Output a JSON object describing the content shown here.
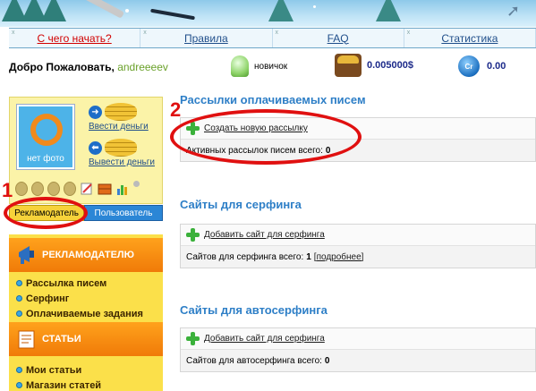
{
  "nav": {
    "tag": "x",
    "items": [
      {
        "label": "С чего начать?"
      },
      {
        "label": "Правила"
      },
      {
        "label": "FAQ"
      },
      {
        "label": "Статистика"
      }
    ]
  },
  "user": {
    "welcome": "Добро Пожаловать,",
    "username": "andreeeev",
    "rank": "новичок",
    "balance": "0.005000$",
    "credits": "0.00",
    "credit_icon_text": "Cr"
  },
  "profile": {
    "avatar_caption": "нет фото",
    "deposit_label": "Ввести деньги",
    "withdraw_label": "Вывести деньги"
  },
  "tabs": {
    "advertiser": "Рекламодатель",
    "user": "Пользователь"
  },
  "menu": {
    "advertiser_header": "РЕКЛАМОДАТЕЛЮ",
    "advertiser_items": [
      "Рассылка писем",
      "Серфинг",
      "Оплачиваемые задания"
    ],
    "articles_header": "СТАТЬИ",
    "articles_items": [
      "Мои статьи",
      "Магазин статей"
    ]
  },
  "main": {
    "mailings": {
      "title": "Рассылки оплачиваемых писем",
      "action": "Создать новую рассылку",
      "stat_label": "Активных рассылок писем всего:",
      "stat_value": "0"
    },
    "surfing": {
      "title": "Сайты для серфинга",
      "action": "Добавить сайт для серфинга",
      "stat_label": "Сайтов для серфинга всего:",
      "stat_value": "1",
      "more": "[подробнее]"
    },
    "autosurfing": {
      "title": "Сайты для автосерфинга",
      "action": "Добавить сайт для серфинга",
      "stat_label": "Сайтов для автосерфинга всего:",
      "stat_value": "0"
    }
  },
  "annotations": {
    "marker_1": "1",
    "marker_2": "2",
    "color": "#e01010"
  },
  "colors": {
    "nav_link": "#1f4e8a",
    "nav_start_link": "#d10000",
    "section_title": "#2e7fc7",
    "menu_header": "#f07a08",
    "menu_bg": "#fbe04a",
    "user_tab": "#2b86d6"
  }
}
